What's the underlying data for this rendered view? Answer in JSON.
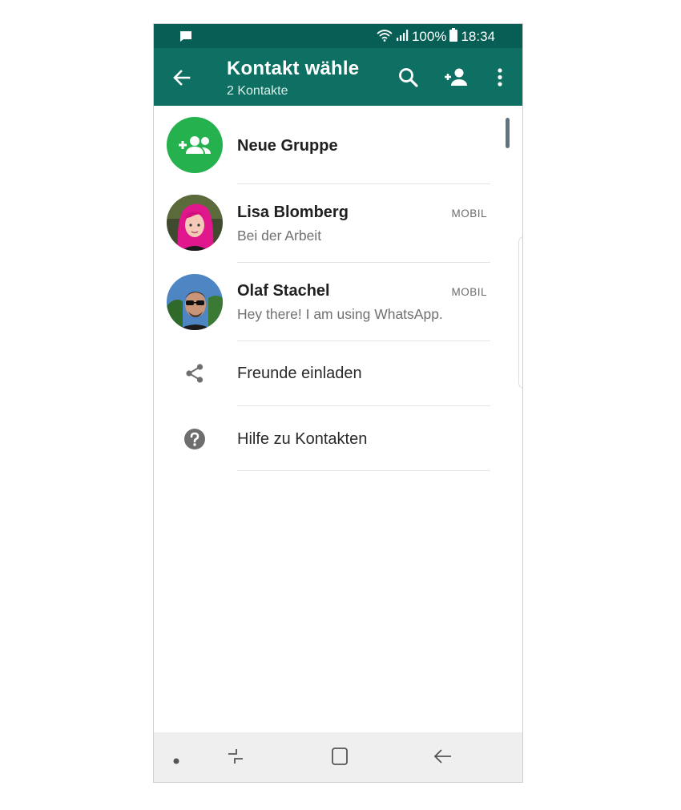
{
  "statusbar": {
    "battery": "100%",
    "time": "18:34",
    "icons": [
      "message-icon",
      "wifi-icon",
      "signal-icon",
      "battery-icon"
    ]
  },
  "appbar": {
    "title": "Kontakt wähle",
    "subtitle": "2 Kontakte",
    "icons": [
      "back-arrow-icon",
      "search-icon",
      "add-contact-icon",
      "more-vert-icon"
    ],
    "color": "#0d7063",
    "status_color": "#075e54"
  },
  "new_group": {
    "label": "Neue Gruppe",
    "icon": "group-add-icon",
    "color": "#25b24e"
  },
  "contacts": [
    {
      "name": "Lisa Blomberg",
      "status": "Bei der Arbeit",
      "type": "MOBIL"
    },
    {
      "name": "Olaf Stachel",
      "status": "Hey there! I am using WhatsApp.",
      "type": "MOBIL"
    }
  ],
  "actions": {
    "invite": {
      "label": "Freunde einladen",
      "icon": "share-icon"
    },
    "help": {
      "label": "Hilfe zu Kontakten",
      "icon": "help-icon"
    }
  },
  "navbar": {
    "icons": [
      "dot-icon",
      "recent-apps-icon",
      "home-icon",
      "back-icon"
    ]
  }
}
